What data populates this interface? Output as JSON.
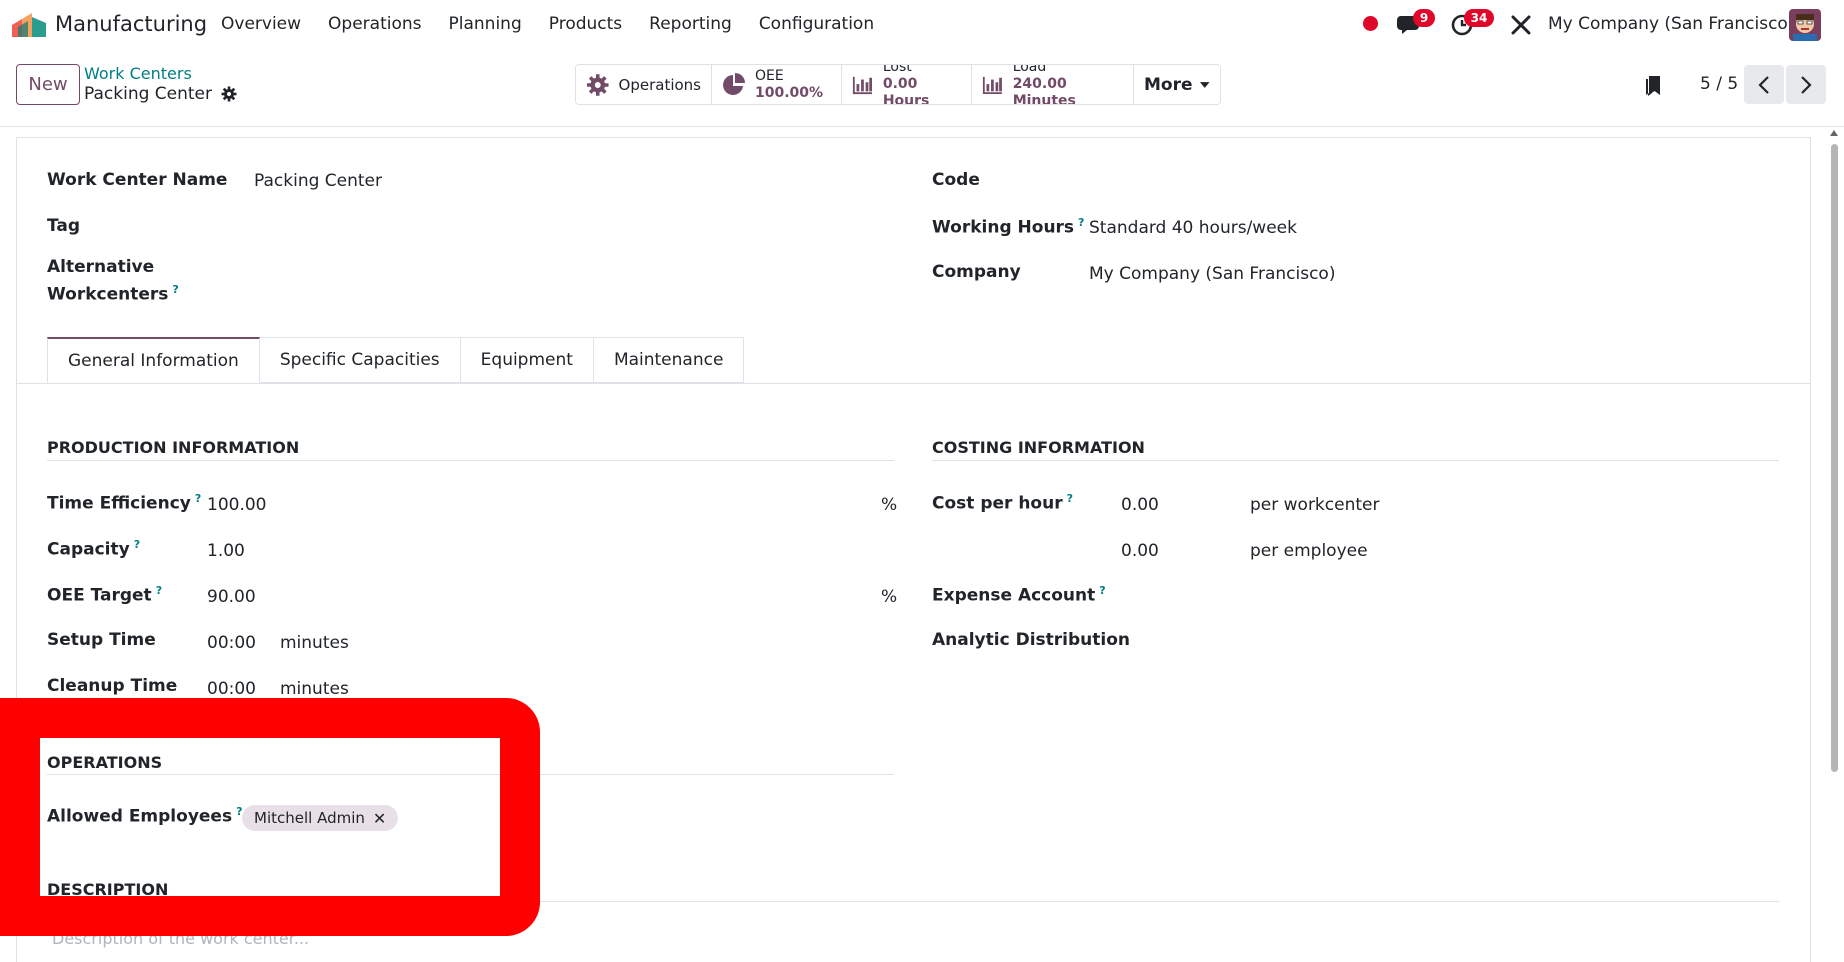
{
  "navbar": {
    "app_name": "Manufacturing",
    "menu": [
      "Overview",
      "Operations",
      "Planning",
      "Products",
      "Reporting",
      "Configuration"
    ],
    "messages_count": "9",
    "activities_count": "34",
    "company": "My Company (San Francisco)"
  },
  "control": {
    "new_label": "New",
    "breadcrumb_parent": "Work Centers",
    "record_name": "Packing Center",
    "stats": {
      "operations_label": "Operations",
      "oee_label": "OEE",
      "oee_value": "100.00%",
      "lost_label": "Lost",
      "lost_value": "0.00 Hours",
      "load_label": "Load",
      "load_value": "240.00 Minutes",
      "more_label": "More"
    },
    "pager": "5 / 5"
  },
  "form": {
    "work_center_name_label": "Work Center Name",
    "work_center_name_value": "Packing Center",
    "tag_label": "Tag",
    "alternative_label_1": "Alternative",
    "alternative_label_2": "Workcenters",
    "code_label": "Code",
    "working_hours_label": "Working Hours",
    "working_hours_value": "Standard 40 hours/week",
    "company_label": "Company",
    "company_value": "My Company (San Francisco)",
    "help_mark": "?"
  },
  "tabs": [
    "General Information",
    "Specific Capacities",
    "Equipment",
    "Maintenance"
  ],
  "production": {
    "title": "PRODUCTION INFORMATION",
    "time_efficiency_label": "Time Efficiency",
    "time_efficiency_value": "100.00",
    "capacity_label": "Capacity",
    "capacity_value": "1.00",
    "oee_target_label": "OEE Target",
    "oee_target_value": "90.00",
    "setup_time_label": "Setup Time",
    "setup_time_value": "00:00",
    "cleanup_time_label": "Cleanup Time",
    "cleanup_time_value": "00:00",
    "minutes_unit": "minutes",
    "percent_unit": "%"
  },
  "costing": {
    "title": "COSTING INFORMATION",
    "cost_per_hour_label": "Cost per hour",
    "cost_workcenter_value": "0.00",
    "cost_workcenter_unit": "per workcenter",
    "cost_employee_value": "0.00",
    "cost_employee_unit": "per employee",
    "expense_account_label": "Expense Account",
    "analytic_label": "Analytic Distribution"
  },
  "operations": {
    "title": "OPERATIONS",
    "allowed_employees_label": "Allowed Employees",
    "employee_tag": "Mitchell Admin",
    "remove_glyph": "✕"
  },
  "description": {
    "title": "DESCRIPTION",
    "placeholder": "Description of the work center..."
  },
  "colors": {
    "brand": "#714b67",
    "teal": "#017e84",
    "badge": "#e0082a",
    "annotation": "#ff0000"
  }
}
